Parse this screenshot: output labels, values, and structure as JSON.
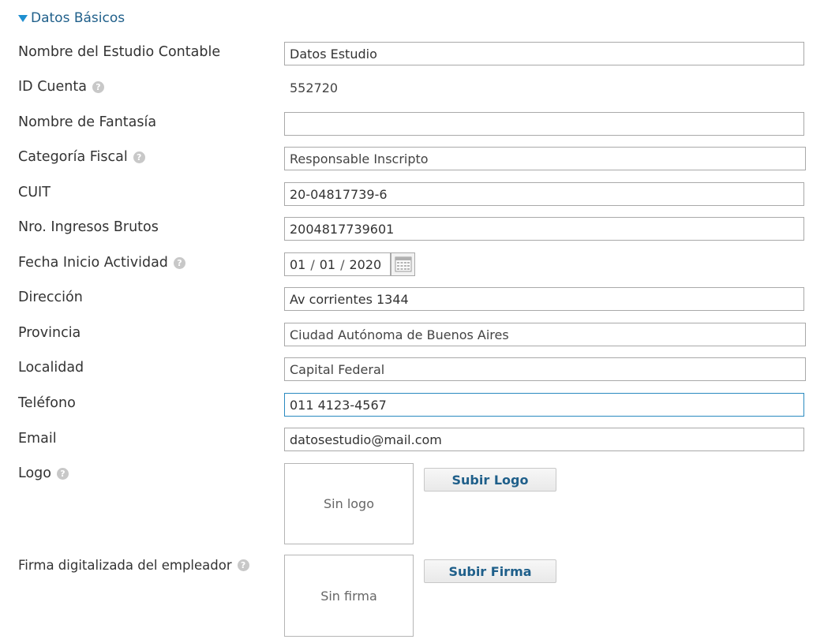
{
  "section": {
    "title": "Datos Básicos"
  },
  "fields": {
    "nombre_estudio": {
      "label": "Nombre del Estudio Contable",
      "value": "Datos Estudio"
    },
    "id_cuenta": {
      "label": "ID Cuenta",
      "value": "552720"
    },
    "nombre_fantasia": {
      "label": "Nombre de Fantasía",
      "value": ""
    },
    "categoria_fiscal": {
      "label": "Categoría Fiscal",
      "value": "Responsable Inscripto"
    },
    "cuit": {
      "label": "CUIT",
      "value": "20-04817739-6"
    },
    "ingresos_brutos": {
      "label": "Nro. Ingresos Brutos",
      "value": "2004817739601"
    },
    "fecha_inicio": {
      "label": "Fecha Inicio Actividad",
      "day": "01",
      "month": "01",
      "year": "2020",
      "separator": "/"
    },
    "direccion": {
      "label": "Dirección",
      "value": "Av corrientes 1344"
    },
    "provincia": {
      "label": "Provincia",
      "value": "Ciudad Autónoma de Buenos Aires"
    },
    "localidad": {
      "label": "Localidad",
      "value": "Capital Federal"
    },
    "telefono": {
      "label": "Teléfono",
      "value": "011 4123-4567"
    },
    "email": {
      "label": "Email",
      "value": "datosestudio@mail.com"
    },
    "logo": {
      "label": "Logo",
      "placeholder": "Sin logo",
      "button": "Subir Logo"
    },
    "firma": {
      "label": "Firma digitalizada del empleador",
      "placeholder": "Sin firma",
      "button": "Subir Firma"
    }
  },
  "icons": {
    "help": "question-circle-icon",
    "calendar": "calendar-icon",
    "collapse": "triangle-down-icon"
  },
  "colors": {
    "accent": "#1f5f8a",
    "triangle": "#1f8fd0",
    "focus_border": "#2a8ac0"
  }
}
